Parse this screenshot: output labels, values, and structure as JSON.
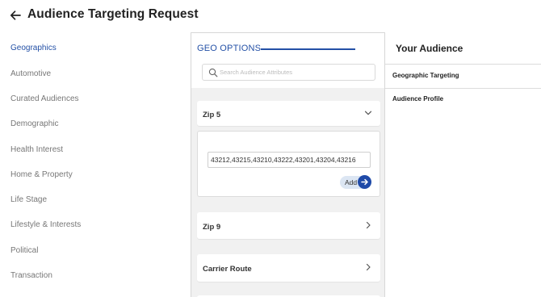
{
  "header": {
    "title": "Audience Targeting Request",
    "back_icon": "arrow-left-icon"
  },
  "sidebar": {
    "items": [
      {
        "label": "Geographics",
        "active": true
      },
      {
        "label": "Automotive"
      },
      {
        "label": "Curated Audiences"
      },
      {
        "label": "Demographic"
      },
      {
        "label": "Health Interest"
      },
      {
        "label": "Home & Property"
      },
      {
        "label": "Life Stage"
      },
      {
        "label": "Lifestyle & Interests"
      },
      {
        "label": "Political"
      },
      {
        "label": "Transaction"
      }
    ]
  },
  "geo": {
    "title": "GEO OPTIONS",
    "search_placeholder": "Search Audience Attributes",
    "zip5": {
      "label": "Zip 5",
      "value": "43212,43215,43210,43222,43201,43204,43216",
      "add_label": "Add"
    },
    "zip9": {
      "label": "Zip 9"
    },
    "carrier_route": {
      "label": "Carrier Route"
    }
  },
  "audience": {
    "title": "Your Audience",
    "sections": [
      "Geographic Targeting",
      "Audience Profile"
    ]
  },
  "colors": {
    "accent": "#2350a6",
    "button": "#1f4aa8",
    "add_pill": "#dce6f3"
  }
}
